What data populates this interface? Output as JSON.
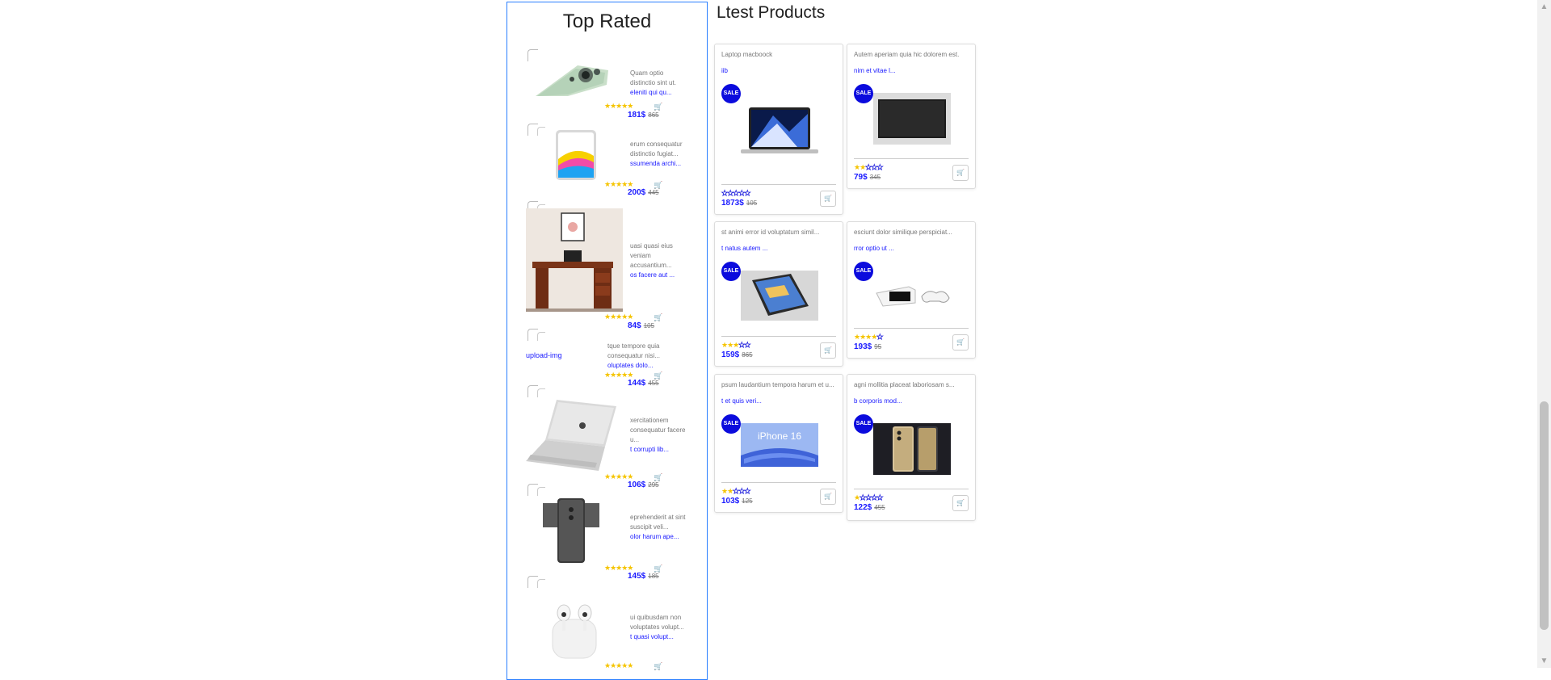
{
  "top_rated": {
    "title": "Top Rated",
    "items": [
      {
        "text": "Quam optio distinctio sint ut.",
        "link": "eleniti qui qu...",
        "price": "181$",
        "old_price": "865",
        "rating": 5
      },
      {
        "text": "erum consequatur distinctio fugiat...",
        "link": "ssumenda archi...",
        "price": "200$",
        "old_price": "445",
        "rating": 5
      },
      {
        "text": "uasi quasi eius veniam accusantium...",
        "link": "os facere aut ...",
        "price": "84$",
        "old_price": "105",
        "rating": 5
      },
      {
        "text": "tque tempore quia consequatur nisi...",
        "link": "oluptates dolo...",
        "price": "144$",
        "old_price": "455",
        "rating": 5,
        "broken_image_alt": "upload-img"
      },
      {
        "text": "xercitationem consequatur facere u...",
        "link": "t corrupti lib...",
        "price": "106$",
        "old_price": "295",
        "rating": 5
      },
      {
        "text": "eprehenderit at sint suscipit veli...",
        "link": "olor harum ape...",
        "price": "145$",
        "old_price": "185",
        "rating": 5
      },
      {
        "text": "ui quibusdam non voluptates volupt...",
        "link": "t quasi volupt...",
        "price": "",
        "old_price": "",
        "rating": 5
      }
    ]
  },
  "latest": {
    "title": "Ltest Products",
    "sale_label": "SALE",
    "cards": [
      {
        "name": "Laptop macboock",
        "desc": "iib",
        "price": "1873$",
        "old_price": "105",
        "rating": 0
      },
      {
        "name": "Autem aperiam quia hic dolorem est.",
        "desc": "nim et vitae l...",
        "price": "79$",
        "old_price": "345",
        "rating": 2
      },
      {
        "name": "st animi error id voluptatum simil...",
        "desc": "t natus autem ...",
        "price": "159$",
        "old_price": "865",
        "rating": 3
      },
      {
        "name": "esciunt dolor similique perspiciat...",
        "desc": "rror optio ut ...",
        "price": "193$",
        "old_price": "95",
        "rating": 4
      },
      {
        "name": "psum laudantium tempora harum et u...",
        "desc": "t et quis veri...",
        "price": "103$",
        "old_price": "125",
        "rating": 2
      },
      {
        "name": "agni mollitia placeat laboriosam s...",
        "desc": "b corporis mod...",
        "price": "122$",
        "old_price": "455",
        "rating": 1
      }
    ]
  },
  "misc": {
    "iphone_text": "iPhone 16",
    "cart_glyph": "🛒",
    "star_glyph": "★"
  }
}
